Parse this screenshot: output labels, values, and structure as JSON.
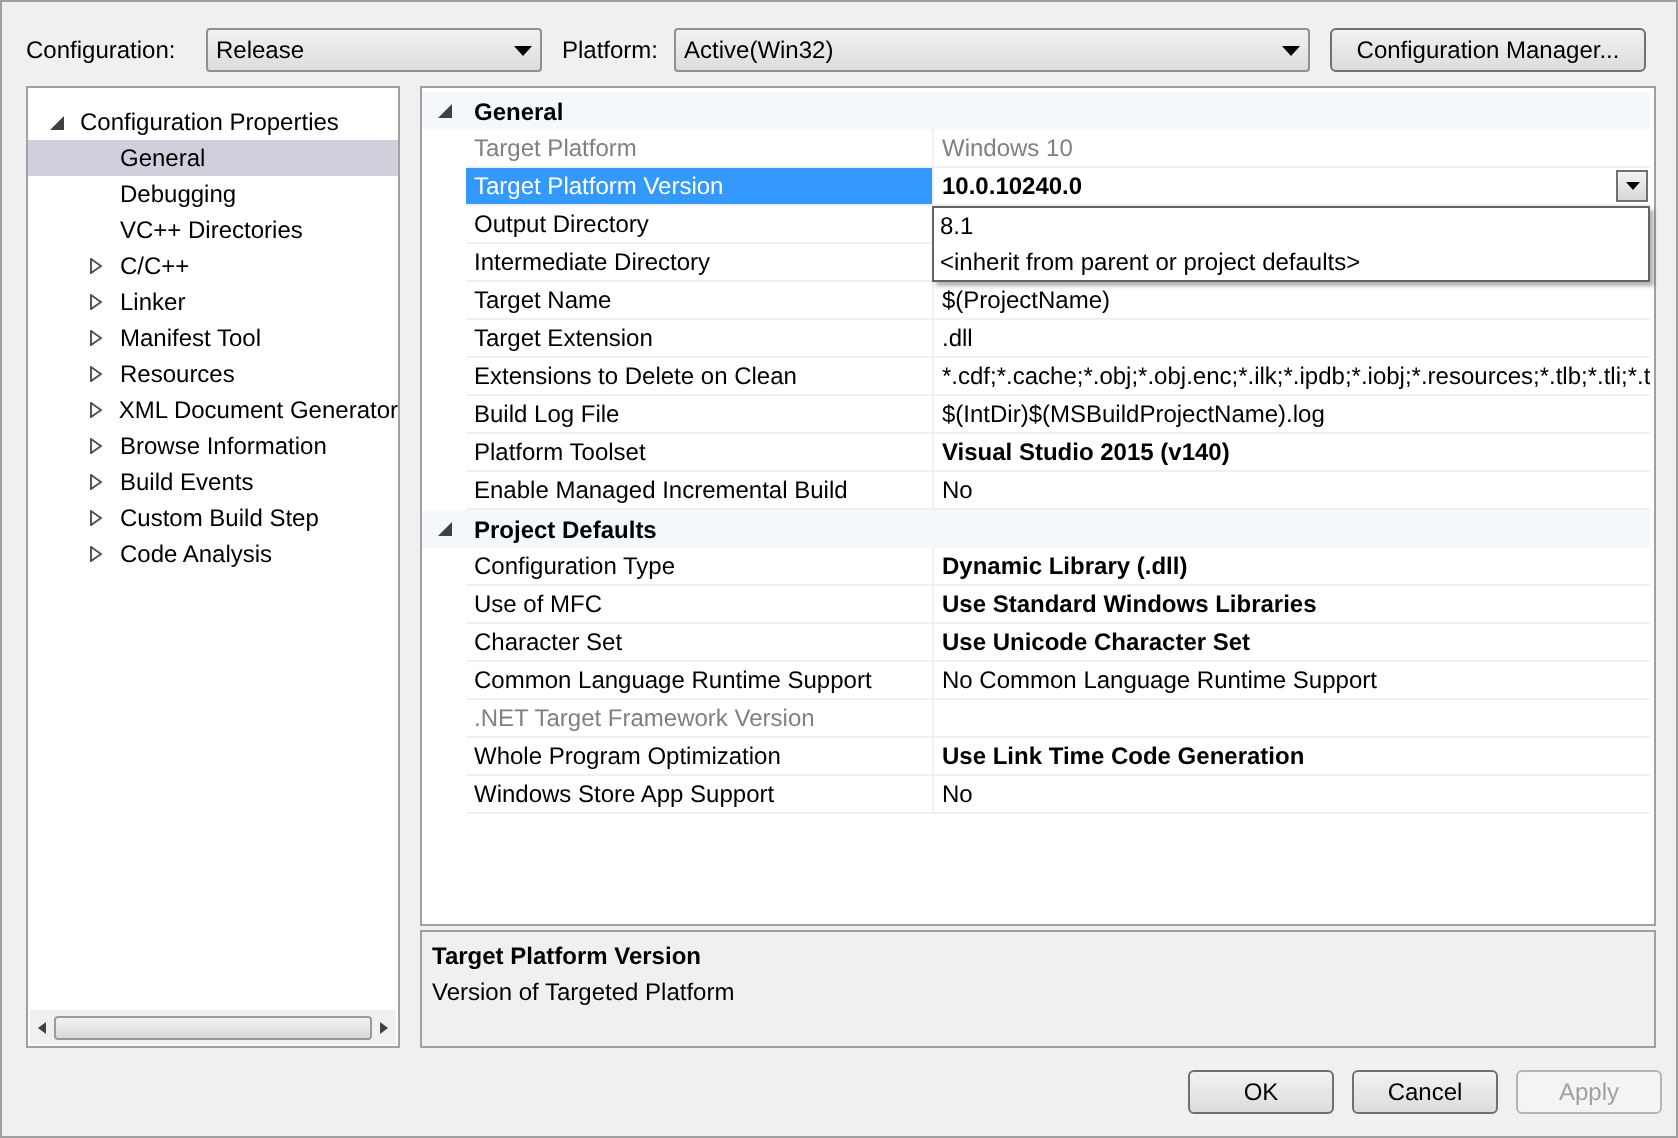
{
  "toolbar": {
    "configuration": {
      "label": "Configuration:",
      "value": "Release"
    },
    "platform": {
      "label": "Platform:",
      "value": "Active(Win32)"
    },
    "manager_button": "Configuration Manager..."
  },
  "tree": [
    {
      "label": "Configuration Properties",
      "expanded": true,
      "selected": false,
      "children": [
        {
          "label": "General",
          "selected": true
        },
        {
          "label": "Debugging",
          "selected": false
        },
        {
          "label": "VC++ Directories",
          "selected": false
        },
        {
          "label": "C/C++",
          "selected": false,
          "expanded": false
        },
        {
          "label": "Linker",
          "selected": false,
          "expanded": false
        },
        {
          "label": "Manifest Tool",
          "selected": false,
          "expanded": false
        },
        {
          "label": "Resources",
          "selected": false,
          "expanded": false
        },
        {
          "label": "XML Document Generator",
          "selected": false,
          "expanded": false
        },
        {
          "label": "Browse Information",
          "selected": false,
          "expanded": false
        },
        {
          "label": "Build Events",
          "selected": false,
          "expanded": false
        },
        {
          "label": "Custom Build Step",
          "selected": false,
          "expanded": false
        },
        {
          "label": "Code Analysis",
          "selected": false,
          "expanded": false
        }
      ]
    }
  ],
  "sections": [
    {
      "title": "General",
      "expanded": true,
      "properties": [
        {
          "label": "Target Platform",
          "value": "Windows 10",
          "bold": false,
          "disabled": true,
          "selected": false
        },
        {
          "label": "Target Platform Version",
          "value": "10.0.10240.0",
          "bold": true,
          "disabled": false,
          "selected": true,
          "dropdown": {
            "options": [
              "8.1",
              "<inherit from parent or project defaults>"
            ]
          }
        },
        {
          "label": "Output Directory",
          "disabled": false,
          "selected": false
        },
        {
          "label": "Intermediate Directory",
          "disabled": false,
          "selected": false
        },
        {
          "label": "Target Name",
          "value": "$(ProjectName)",
          "bold": false,
          "disabled": false,
          "selected": false
        },
        {
          "label": "Target Extension",
          "value": ".dll",
          "bold": false,
          "disabled": false,
          "selected": false
        },
        {
          "label": "Extensions to Delete on Clean",
          "value": "*.cdf;*.cache;*.obj;*.obj.enc;*.ilk;*.ipdb;*.iobj;*.resources;*.tlb;*.tli;*.t",
          "bold": false,
          "disabled": false,
          "selected": false
        },
        {
          "label": "Build Log File",
          "value": "$(IntDir)$(MSBuildProjectName).log",
          "bold": false,
          "disabled": false,
          "selected": false
        },
        {
          "label": "Platform Toolset",
          "value": "Visual Studio 2015 (v140)",
          "bold": true,
          "disabled": false,
          "selected": false
        },
        {
          "label": "Enable Managed Incremental Build",
          "value": "No",
          "bold": false,
          "disabled": false,
          "selected": false
        }
      ]
    },
    {
      "title": "Project Defaults",
      "expanded": true,
      "properties": [
        {
          "label": "Configuration Type",
          "value": "Dynamic Library (.dll)",
          "bold": true,
          "disabled": false,
          "selected": false
        },
        {
          "label": "Use of MFC",
          "value": "Use Standard Windows Libraries",
          "bold": true,
          "disabled": false,
          "selected": false
        },
        {
          "label": "Character Set",
          "value": "Use Unicode Character Set",
          "bold": true,
          "disabled": false,
          "selected": false
        },
        {
          "label": "Common Language Runtime Support",
          "value": "No Common Language Runtime Support",
          "bold": false,
          "disabled": false,
          "selected": false
        },
        {
          "label": ".NET Target Framework Version",
          "disabled": true,
          "selected": false
        },
        {
          "label": "Whole Program Optimization",
          "value": "Use Link Time Code Generation",
          "bold": true,
          "disabled": false,
          "selected": false
        },
        {
          "label": "Windows Store App Support",
          "value": "No",
          "bold": false,
          "disabled": false,
          "selected": false
        }
      ]
    }
  ],
  "description": {
    "title": "Target Platform Version",
    "text": "Version of Targeted Platform"
  },
  "buttons": [
    {
      "label": "OK",
      "disabled": false
    },
    {
      "label": "Cancel",
      "disabled": false
    },
    {
      "label": "Apply",
      "disabled": true
    }
  ]
}
